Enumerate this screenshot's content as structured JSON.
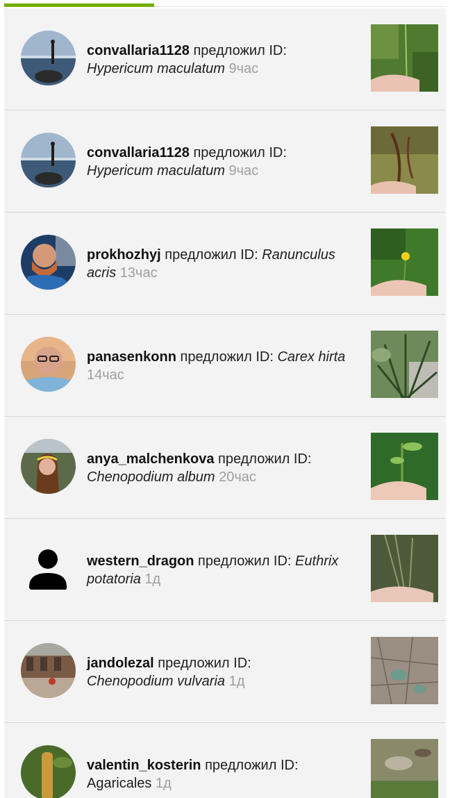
{
  "verb": "предложил ID:",
  "items": [
    {
      "user": "convallaria1128",
      "taxon": "Hypericum maculatum",
      "italic": true,
      "time": "9час"
    },
    {
      "user": "convallaria1128",
      "taxon": "Hypericum maculatum",
      "italic": true,
      "time": "9час"
    },
    {
      "user": "prokhozhyj",
      "taxon": "Ranunculus acris",
      "italic": true,
      "time": "13час"
    },
    {
      "user": "panasenkonn",
      "taxon": "Carex hirta",
      "italic": true,
      "time": "14час"
    },
    {
      "user": "anya_malchenkova",
      "taxon": "Chenopodium album",
      "italic": true,
      "time": "20час"
    },
    {
      "user": "western_dragon",
      "taxon": "Euthrix potatoria",
      "italic": true,
      "time": "1д"
    },
    {
      "user": "jandolezal",
      "taxon": "Chenopodium vulvaria",
      "italic": true,
      "time": "1д"
    },
    {
      "user": "valentin_kosterin",
      "taxon": "Agaricales",
      "italic": false,
      "time": "1д"
    }
  ],
  "colors": {
    "accent": "#74ac00",
    "row_bg": "#f3f3f3",
    "divider": "#d7d7d7",
    "time": "#9e9e9e"
  }
}
